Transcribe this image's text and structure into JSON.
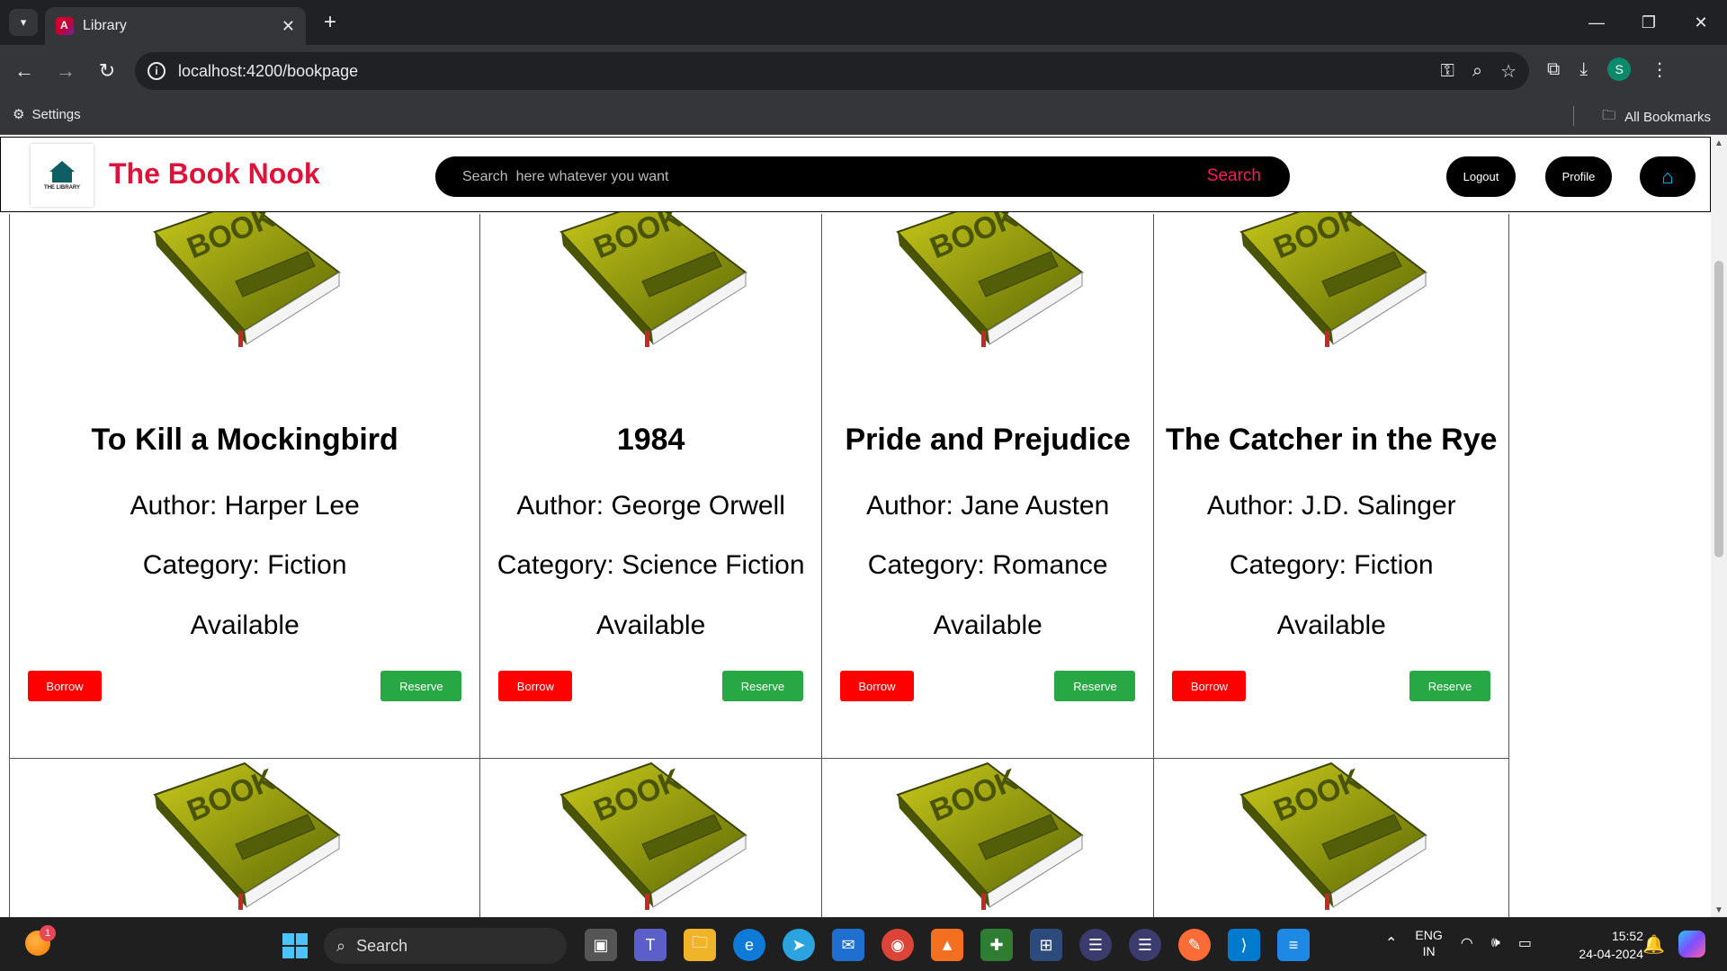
{
  "browser": {
    "tab_title": "Library",
    "url": "localhost:4200/bookpage",
    "bookmarks_settings": "Settings",
    "bookmarks_all": "All Bookmarks",
    "profile_initial": "S"
  },
  "header": {
    "logo_text": "THE LIBRARY",
    "brand": "The Book Nook",
    "search_placeholder": "Search  here whatever you want",
    "search_button": "Search",
    "logout": "Logout",
    "profile": "Profile"
  },
  "books": [
    {
      "title": "To Kill a Mockingbird",
      "author": "Author: Harper Lee",
      "category": "Category: Fiction",
      "status": "Available",
      "borrow": "Borrow",
      "reserve": "Reserve"
    },
    {
      "title": "1984",
      "author": "Author: George Orwell",
      "category": "Category: Science Fiction",
      "status": "Available",
      "borrow": "Borrow",
      "reserve": "Reserve"
    },
    {
      "title": "Pride and Prejudice",
      "author": "Author: Jane Austen",
      "category": "Category: Romance",
      "status": "Available",
      "borrow": "Borrow",
      "reserve": "Reserve"
    },
    {
      "title": "The Catcher in the Rye",
      "author": "Author: J.D. Salinger",
      "category": "Category: Fiction",
      "status": "Available",
      "borrow": "Borrow",
      "reserve": "Reserve"
    }
  ],
  "book_image_label": "BOOK",
  "taskbar": {
    "search": "Search",
    "weather_badge": "1",
    "lang_line1": "ENG",
    "lang_line2": "IN",
    "time": "15:52",
    "date": "24-04-2024"
  },
  "colors": {
    "brand": "#dc143c",
    "borrow": "#ff0000",
    "reserve": "#28a745",
    "search_text": "#ff1a5e"
  }
}
